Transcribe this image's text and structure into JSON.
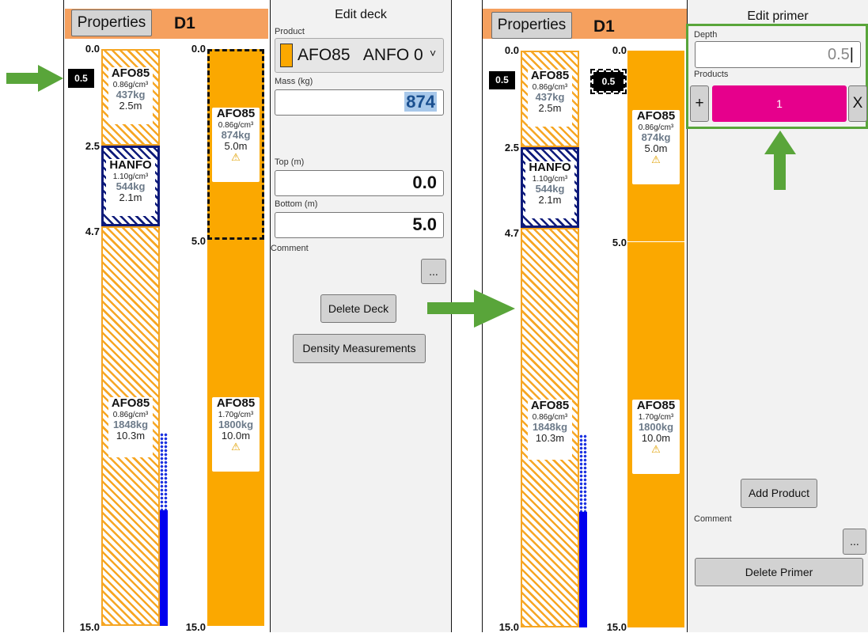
{
  "left_screen": {
    "properties_label": "Properties",
    "hole_id": "D1",
    "column_a_ticks": [
      "0.0",
      "2.5",
      "4.7",
      "15.0"
    ],
    "column_b_ticks": [
      "0.0",
      "5.0",
      "15.0"
    ],
    "primer_a": "0.5",
    "decks_a": [
      {
        "name": "AFO85",
        "density": "0.86g/cm³",
        "mass": "437kg",
        "length": "2.5m"
      },
      {
        "name": "HANFO",
        "density": "1.10g/cm³",
        "mass": "544kg",
        "length": "2.1m"
      },
      {
        "name": "AFO85",
        "density": "0.86g/cm³",
        "mass": "1848kg",
        "length": "10.3m"
      }
    ],
    "decks_b": [
      {
        "name": "AFO85",
        "density": "0.86g/cm³",
        "mass": "874kg",
        "length": "5.0m",
        "warn": "⚠"
      },
      {
        "name": "AFO85",
        "density": "1.70g/cm³",
        "mass": "1800kg",
        "length": "10.0m",
        "warn": "⚠"
      }
    ],
    "edit_deck": {
      "title": "Edit deck",
      "product_label": "Product",
      "product_value": "AFO85   ANFO 0",
      "product_chevron": "˅",
      "mass_label": "Mass (kg)",
      "mass_value": "874",
      "top_label": "Top (m)",
      "top_value": "0.0",
      "bottom_label": "Bottom (m)",
      "bottom_value": "5.0",
      "comment_label": "Comment",
      "ellipsis": "...",
      "delete_deck": "Delete Deck",
      "density_measurements": "Density Measurements"
    }
  },
  "right_screen": {
    "properties_label": "Properties",
    "hole_id": "D1",
    "column_a_ticks": [
      "0.0",
      "2.5",
      "4.7",
      "15.0"
    ],
    "column_b_ticks": [
      "0.0",
      "5.0",
      "15.0"
    ],
    "primer_a": "0.5",
    "primer_b": "0.5",
    "decks_a": [
      {
        "name": "AFO85",
        "density": "0.86g/cm³",
        "mass": "437kg",
        "length": "2.5m"
      },
      {
        "name": "HANFO",
        "density": "1.10g/cm³",
        "mass": "544kg",
        "length": "2.1m"
      },
      {
        "name": "AFO85",
        "density": "0.86g/cm³",
        "mass": "1848kg",
        "length": "10.3m"
      }
    ],
    "decks_b": [
      {
        "name": "AFO85",
        "density": "0.86g/cm³",
        "mass": "874kg",
        "length": "5.0m",
        "warn": "⚠"
      },
      {
        "name": "AFO85",
        "density": "1.70g/cm³",
        "mass": "1800kg",
        "length": "10.0m",
        "warn": "⚠"
      }
    ],
    "edit_primer": {
      "title": "Edit primer",
      "depth_label": "Depth",
      "depth_value": "0.5",
      "products_label": "Products",
      "plus": "+",
      "product_count": "1",
      "remove": "X",
      "add_product": "Add Product",
      "comment_label": "Comment",
      "ellipsis": "...",
      "delete_primer": "Delete Primer"
    }
  },
  "colors": {
    "header_bar": "#f5a05e",
    "explosive": "#fba800",
    "hanfo": "#0d1a7a",
    "primer_product": "#e6008c",
    "arrow": "#59a53a",
    "highlight": "#59a53a",
    "water": "#0000ee"
  }
}
